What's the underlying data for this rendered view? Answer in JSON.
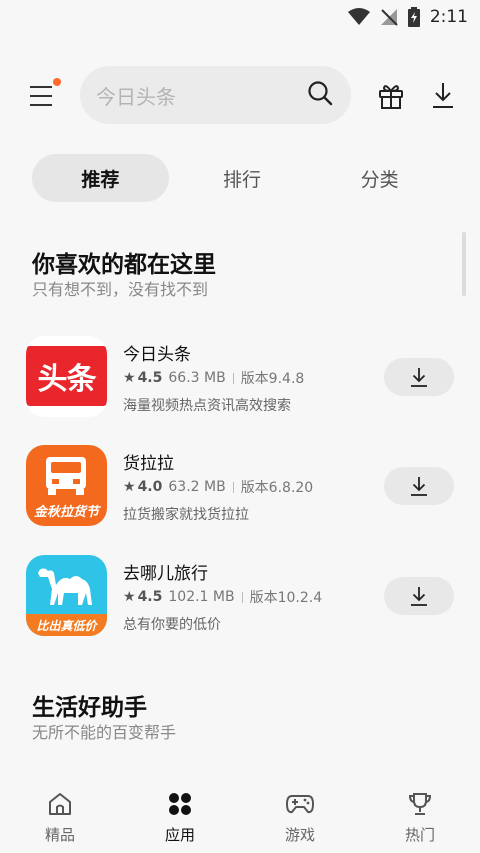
{
  "status_bar": {
    "time": "2:11"
  },
  "search": {
    "placeholder": "今日头条"
  },
  "tabs": [
    {
      "label": "推荐",
      "active": true
    },
    {
      "label": "排行",
      "active": false
    },
    {
      "label": "分类",
      "active": false
    }
  ],
  "sections": [
    {
      "title": "你喜欢的都在这里",
      "subtitle": "只有想不到，没有找不到"
    },
    {
      "title": "生活好助手",
      "subtitle": "无所不能的百变帮手"
    }
  ],
  "apps": [
    {
      "name": "今日头条",
      "rating": "4.5",
      "size": "66.3 MB",
      "version": "版本9.4.8",
      "description": "海量视频热点资讯高效搜索",
      "icon_text": "头条"
    },
    {
      "name": "货拉拉",
      "rating": "4.0",
      "size": "63.2 MB",
      "version": "版本6.8.20",
      "description": "拉货搬家就找货拉拉",
      "icon_text": "金秋拉货节"
    },
    {
      "name": "去哪儿旅行",
      "rating": "4.5",
      "size": "102.1 MB",
      "version": "版本10.2.4",
      "description": "总有你要的低价",
      "icon_text": "比出真低价"
    }
  ],
  "bottom_nav": [
    {
      "label": "精品",
      "icon": "home-icon",
      "active": false
    },
    {
      "label": "应用",
      "icon": "apps-grid-icon",
      "active": true
    },
    {
      "label": "游戏",
      "icon": "gamepad-icon",
      "active": false
    },
    {
      "label": "热门",
      "icon": "trophy-icon",
      "active": false
    }
  ],
  "colors": {
    "notification_dot": "#ff6a2b",
    "toutiao_red": "#e8262b",
    "huolala_orange": "#f36a1e",
    "qunar_blue": "#2fc3e8"
  }
}
